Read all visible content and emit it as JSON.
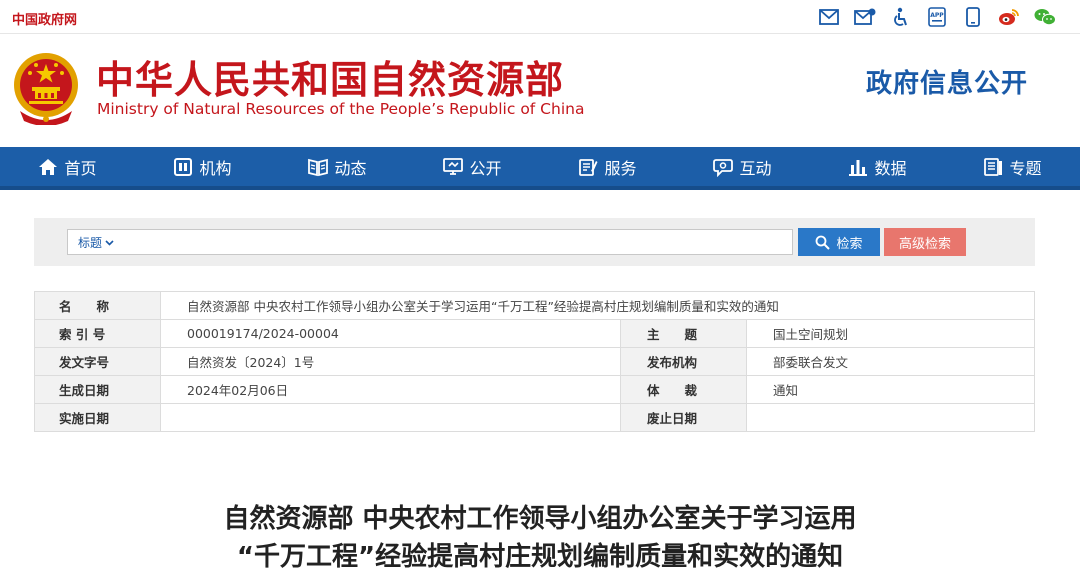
{
  "topbar": {
    "gov_link": "中国政府网",
    "icons": [
      "mail-icon",
      "subscribe-icon",
      "accessibility-icon",
      "app-icon",
      "mobile-icon",
      "weibo-icon",
      "wechat-icon"
    ]
  },
  "header": {
    "name_cn": "中华人民共和国自然资源部",
    "name_en": "Ministry of Natural Resources of the People’s Republic of China",
    "gov_info": "政府信息公开"
  },
  "nav": {
    "items": [
      {
        "label": "首页",
        "icon": "home-icon"
      },
      {
        "label": "机构",
        "icon": "organization-icon"
      },
      {
        "label": "动态",
        "icon": "news-icon"
      },
      {
        "label": "公开",
        "icon": "publish-icon"
      },
      {
        "label": "服务",
        "icon": "service-icon"
      },
      {
        "label": "互动",
        "icon": "chat-icon"
      },
      {
        "label": "数据",
        "icon": "chart-icon"
      },
      {
        "label": "专题",
        "icon": "topic-icon"
      }
    ]
  },
  "search": {
    "type_label": "标题",
    "placeholder": "",
    "search_label": "检索",
    "advanced_label": "高级检索"
  },
  "info": {
    "name_label": "名　　称",
    "name_value": "自然资源部 中央农村工作领导小组办公室关于学习运用“千万工程”经验提高村庄规划编制质量和实效的通知",
    "index_label": "索 引 号",
    "index_value": "000019174/2024-00004",
    "subject_label": "主　　题",
    "subject_value": "国土空间规划",
    "doc_no_label": "发文字号",
    "doc_no_value": "自然资发〔2024〕1号",
    "issuer_label": "发布机构",
    "issuer_value": "部委联合发文",
    "date_label": "生成日期",
    "date_value": "2024年02月06日",
    "genre_label": "体　　裁",
    "genre_value": "通知",
    "effective_label": "实施日期",
    "effective_value": "",
    "expiry_label": "废止日期",
    "expiry_value": ""
  },
  "article": {
    "title_line1": "自然资源部 中央农村工作领导小组办公室关于学习运用",
    "title_line2": "“千万工程”经验提高村庄规划编制质量和实效的通知"
  },
  "colors": {
    "brand_red": "#c4161c",
    "nav_blue": "#1c5ea8",
    "title_blue": "#1a5aa8",
    "search_blue": "#2a78c8",
    "advanced_red": "#e8766d"
  }
}
